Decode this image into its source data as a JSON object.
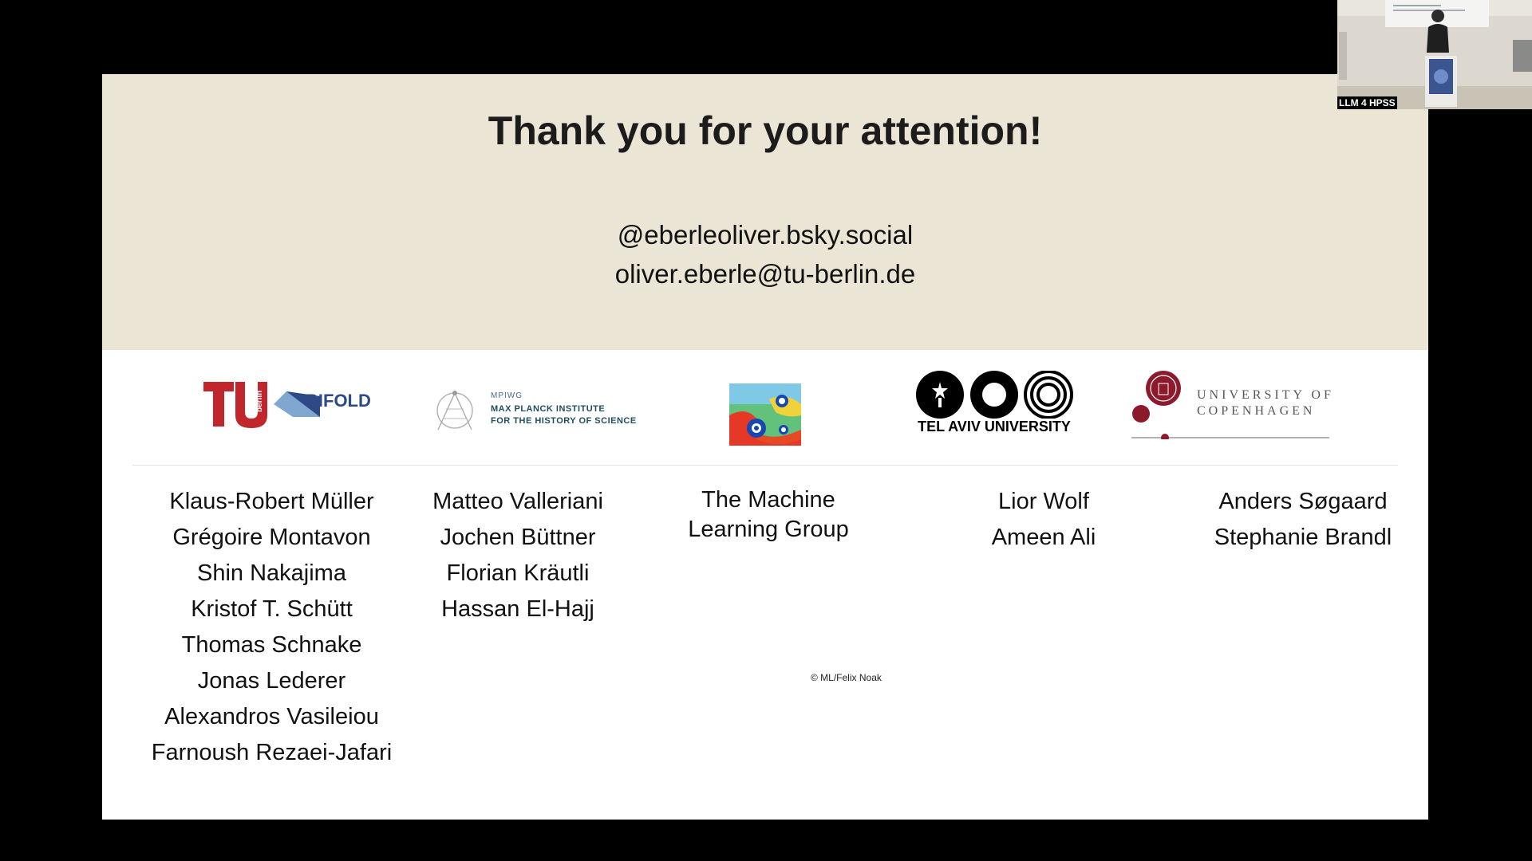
{
  "slide": {
    "title": "Thank you for your attention!",
    "contact_bsky": "@eberleoliver.bsky.social",
    "contact_email": "oliver.eberle@tu-berlin.de",
    "logos": {
      "tu_berlin": {
        "wordmark": "berlin",
        "partner": "BIFOLD"
      },
      "mpiwg": {
        "acronym": "MPIWG",
        "line1": "MAX PLANCK INSTITUTE",
        "line2": "FOR THE HISTORY OF SCIENCE"
      },
      "tel_aviv": {
        "name": "TEL AVIV UNIVERSITY"
      },
      "copenhagen": {
        "line1": "UNIVERSITY OF",
        "line2": "COPENHAGEN"
      }
    },
    "columns": {
      "tu_berlin": [
        "Klaus-Robert Müller",
        "Grégoire Montavon",
        "Shin Nakajima",
        "Kristof T. Schütt",
        "Thomas Schnake",
        "Jonas Lederer",
        "Alexandros Vasileiou",
        "Farnoush Rezaei-Jafari"
      ],
      "mpiwg": [
        "Matteo Valleriani",
        "Jochen Büttner",
        "Florian Kräutli",
        "Hassan El-Hajj"
      ],
      "ml_group": [
        "The Machine",
        "Learning Group"
      ],
      "tel_aviv": [
        "Lior Wolf",
        "Ameen Ali"
      ],
      "copenhagen": [
        "Anders Søgaard",
        "Stephanie Brandl"
      ]
    },
    "credit": "© ML/Felix Noak"
  },
  "webcam": {
    "label": "LLM 4 HPSS"
  },
  "colors": {
    "header_bg": "#ebe5d6",
    "tu_red": "#c0262c",
    "bifold_blue": "#2e4a86",
    "copenhagen_red": "#8b1a2c"
  }
}
